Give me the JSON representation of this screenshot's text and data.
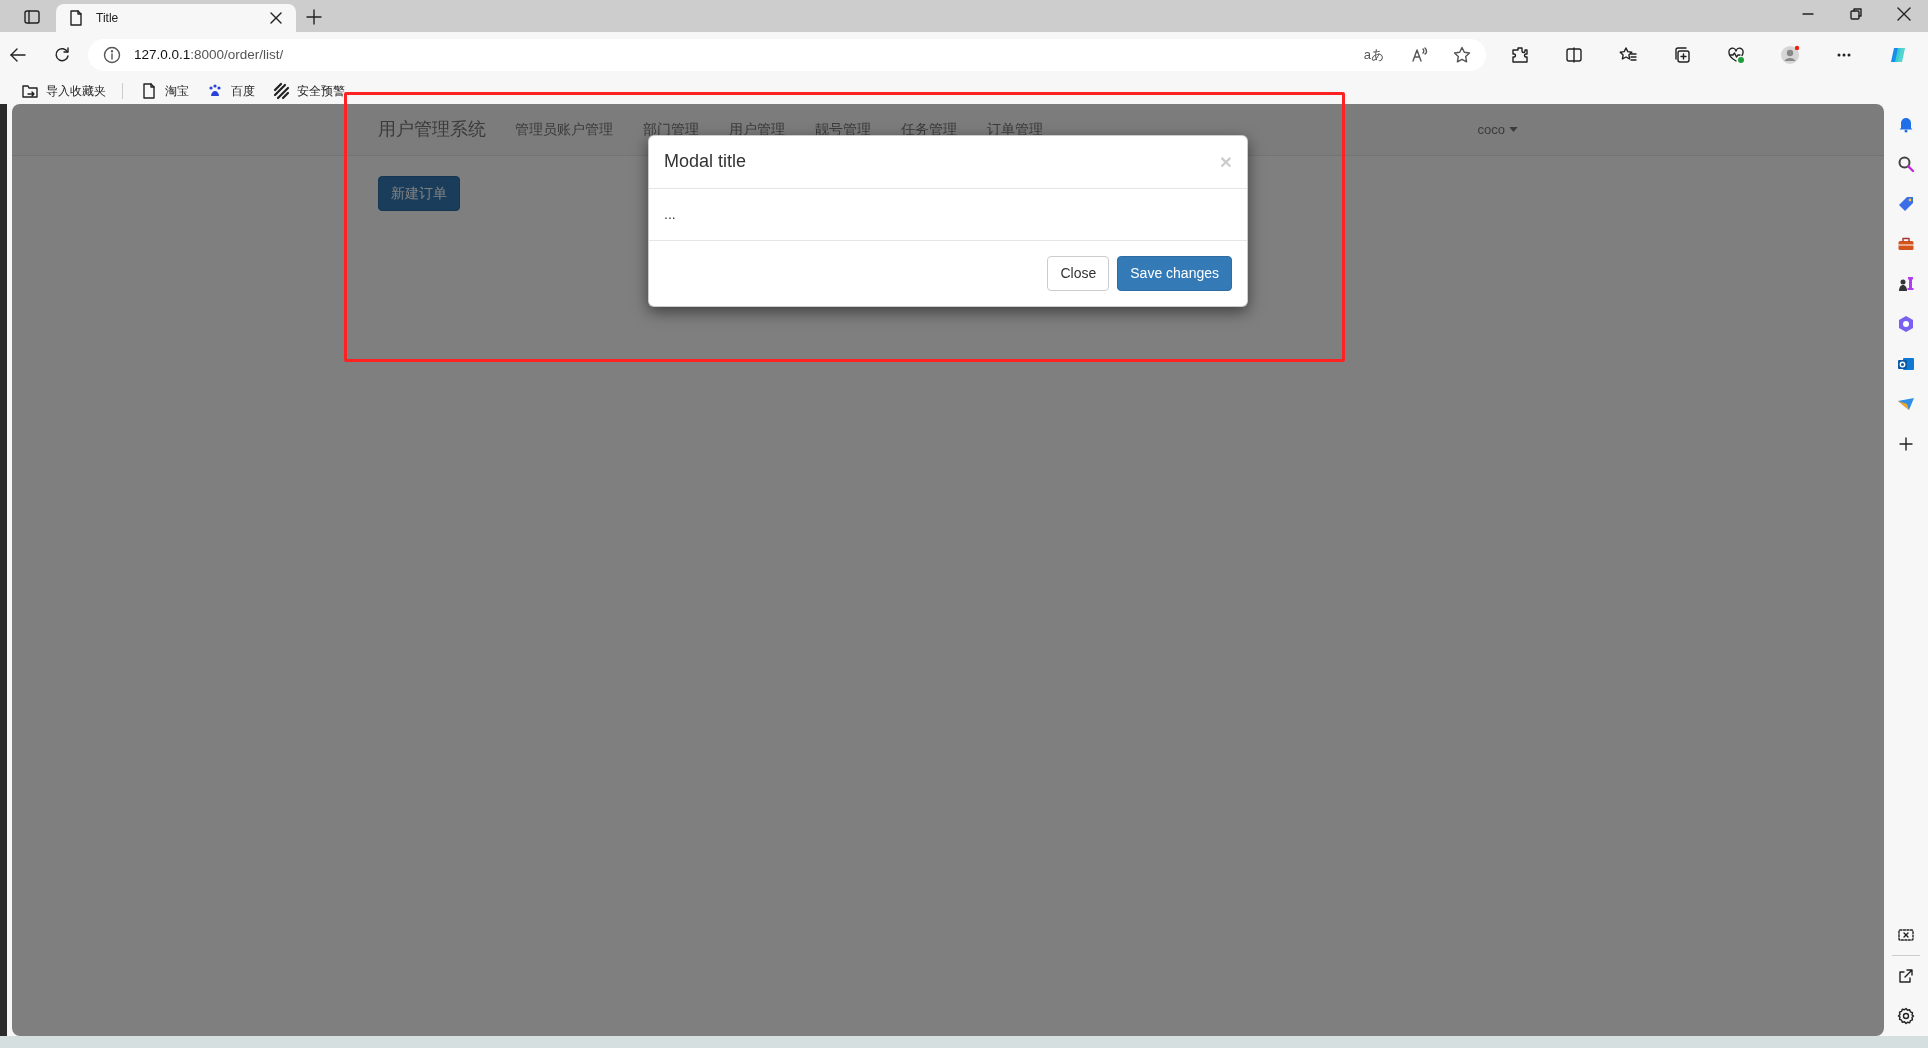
{
  "browser": {
    "tabs": [
      {
        "title": "Title",
        "selected": true
      }
    ],
    "address": {
      "host": "127.0.0.1",
      "path": ":8000/order/list/"
    },
    "translate_glyph": "aあ",
    "bookmarks": [
      {
        "label": "导入收藏夹",
        "kind": "import"
      },
      {
        "label": "淘宝",
        "kind": "page"
      },
      {
        "label": "百度",
        "kind": "paw"
      },
      {
        "label": "安全预警",
        "kind": "stripes"
      }
    ]
  },
  "navbar": {
    "brand": "用户管理系统",
    "items": [
      "管理员账户管理",
      "部门管理",
      "用户管理",
      "靓号管理",
      "任务管理",
      "订单管理"
    ],
    "user": "coco"
  },
  "new_button": "新建订单",
  "modal": {
    "title": "Modal title",
    "close": "×",
    "body": "...",
    "buttons": [
      {
        "label": "Close",
        "kind": "default"
      },
      {
        "label": "Save changes",
        "kind": "primary"
      }
    ]
  }
}
